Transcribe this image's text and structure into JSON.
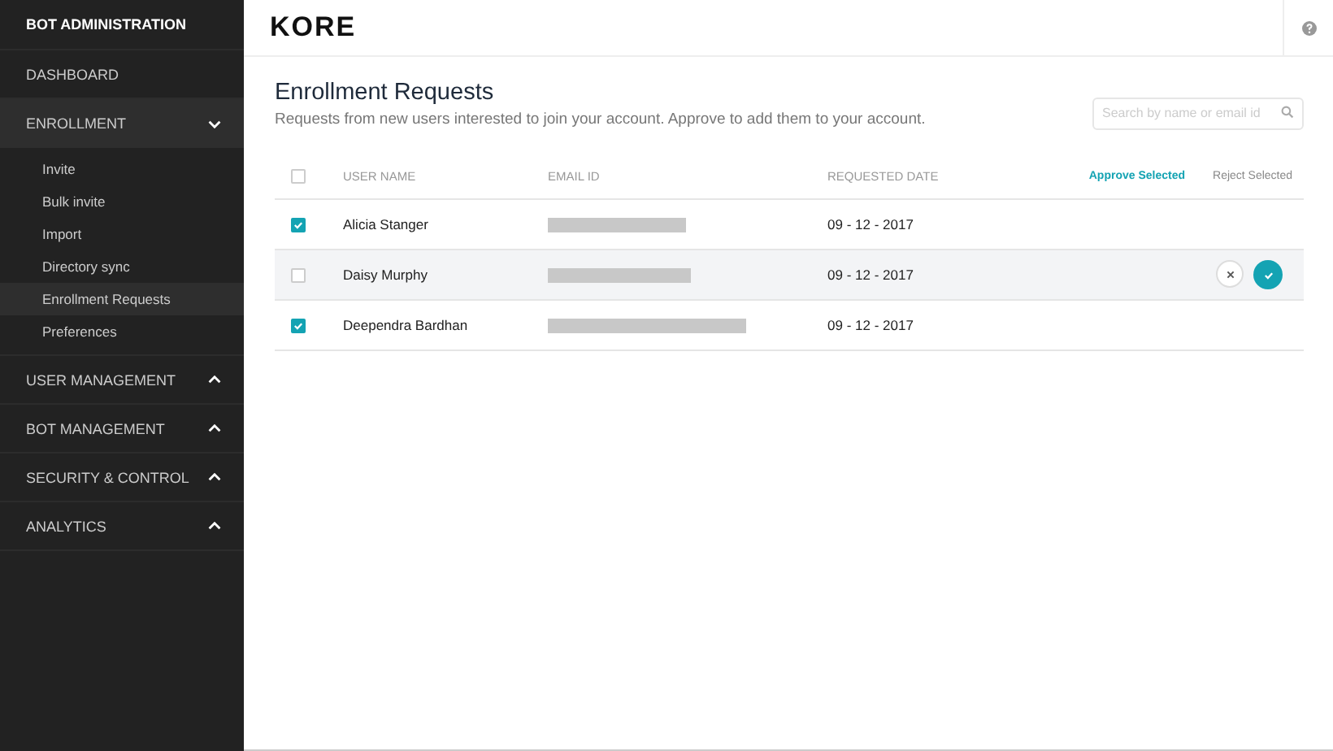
{
  "sidebar": {
    "title": "BOT ADMINISTRATION",
    "items": [
      {
        "label": "DASHBOARD"
      },
      {
        "label": "ENROLLMENT",
        "expanded": true,
        "children": [
          {
            "label": "Invite",
            "selected": false
          },
          {
            "label": "Bulk invite",
            "selected": false
          },
          {
            "label": "Import",
            "selected": false
          },
          {
            "label": "Directory sync",
            "selected": false
          },
          {
            "label": "Enrollment Requests",
            "selected": true
          },
          {
            "label": "Preferences",
            "selected": false
          }
        ]
      },
      {
        "label": "USER MANAGEMENT",
        "expanded": false
      },
      {
        "label": "BOT MANAGEMENT",
        "expanded": false
      },
      {
        "label": "SECURITY & CONTROL",
        "expanded": false
      },
      {
        "label": "ANALYTICS",
        "expanded": false
      }
    ]
  },
  "header": {
    "logo": "KORE"
  },
  "page": {
    "title": "Enrollment Requests",
    "subtitle": "Requests from new users interested to join your account. Approve to add them to your account.",
    "search": {
      "placeholder": "Search by name or email id"
    }
  },
  "table": {
    "select_all": {
      "checked": false
    },
    "columns": [
      "USER NAME",
      "EMAIL ID",
      "REQUESTED DATE"
    ],
    "actions": [
      "Approve Selected",
      "Reject Selected"
    ],
    "rows": [
      {
        "name": "Alicia Stanger",
        "date": "09 - 12 - 2017",
        "checked": true,
        "highlighted": false
      },
      {
        "name": "Daisy Murphy",
        "date": "09 - 12 - 2017",
        "checked": false,
        "highlighted": true
      },
      {
        "name": "Deependra Bardhan",
        "date": "09 - 12 - 2017",
        "checked": true,
        "highlighted": false
      }
    ]
  }
}
